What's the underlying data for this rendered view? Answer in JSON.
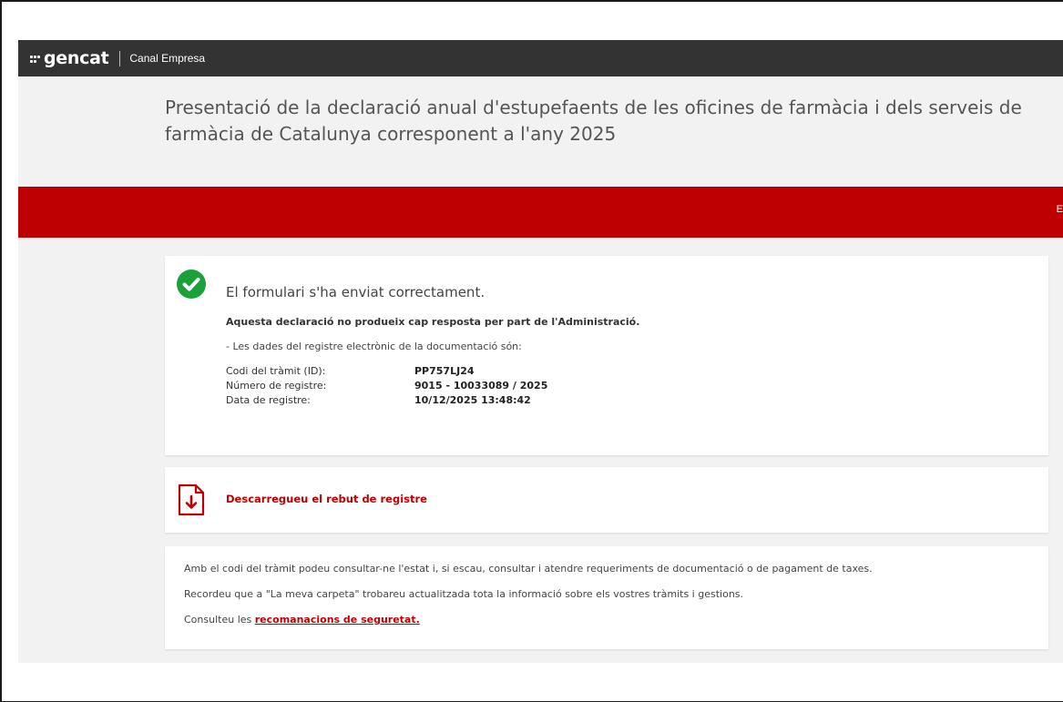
{
  "header": {
    "logo_text": "gencat",
    "section_name": "Canal Empresa"
  },
  "page": {
    "title": "Presentació de la declaració anual d'estupefaents de les oficines de farmàcia i dels serveis de farmàcia de Catalunya corresponent a l'any 2025",
    "red_band_edge_letter": "E"
  },
  "confirmation": {
    "success_message": "El formulari s'ha enviat correctament.",
    "no_response_notice": "Aquesta declaració no produeix cap resposta per part de l'Administració.",
    "registry_intro": "- Les dades del registre electrònic de la documentació són:",
    "fields": [
      {
        "label": "Codi del tràmit (ID):",
        "value": "PP757LJ24"
      },
      {
        "label": "Número de registre:",
        "value": "9015 - 10033089 / 2025"
      },
      {
        "label": "Data de registre:",
        "value": "10/12/2025 13:48:42"
      }
    ]
  },
  "download": {
    "link_label": "Descarregueu el rebut de registre"
  },
  "info": {
    "line1": "Amb el codi del tràmit podeu consultar-ne l'estat i, si escau, consultar i atendre requeriments de documentació o de pagament de taxes.",
    "line2": "Recordeu que a \"La meva carpeta\" trobareu actualitzada tota la informació sobre els vostres tràmits i gestions.",
    "line3_prefix": "Consulteu les ",
    "line3_link": "recomanacions de seguretat."
  },
  "colors": {
    "topbar": "#333333",
    "accent_red": "#bf0000",
    "success_green": "#1aa13a",
    "page_bg": "#f2f2f2"
  },
  "icons": {
    "success": "check-circle-icon",
    "download": "pdf-download-icon",
    "logo": "gencat-dots-logo"
  }
}
